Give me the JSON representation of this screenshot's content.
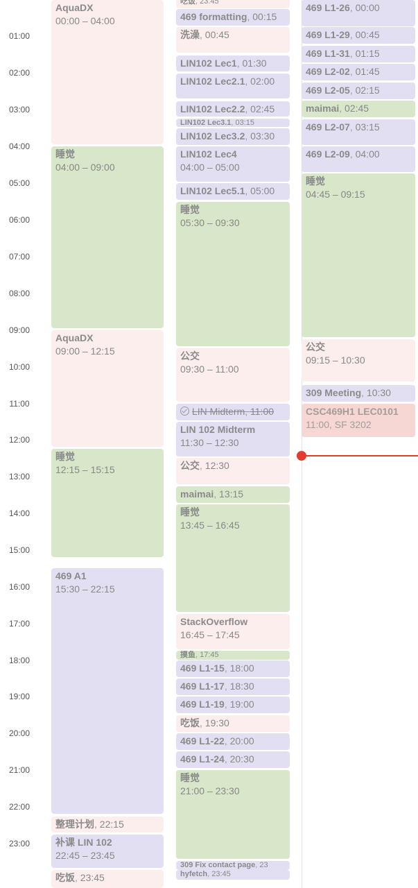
{
  "timeline": {
    "hours": [
      "01:00",
      "02:00",
      "03:00",
      "04:00",
      "05:00",
      "06:00",
      "07:00",
      "08:00",
      "09:00",
      "10:00",
      "11:00",
      "12:00",
      "13:00",
      "14:00",
      "15:00",
      "16:00",
      "17:00",
      "18:00",
      "19:00",
      "20:00",
      "21:00",
      "22:00",
      "23:00"
    ]
  },
  "days": [
    {
      "events": [
        {
          "title": "AquaDX",
          "time": "00:00 – 04:00",
          "color": "pink"
        },
        {
          "title": "睡觉",
          "time": "04:00 – 09:00",
          "color": "green"
        },
        {
          "title": "AquaDX",
          "time": "09:00 – 12:15",
          "color": "pink"
        },
        {
          "title": "睡觉",
          "time": "12:15 – 15:15",
          "color": "green"
        },
        {
          "title": "469 A1",
          "time": "15:30 – 22:15",
          "color": "purple"
        },
        {
          "title": "整理计划",
          "time": "22:15",
          "color": "pink"
        },
        {
          "title": "补课 LIN 102",
          "time": "22:45 – 23:45",
          "color": "purple"
        },
        {
          "title": "吃饭",
          "time": "23:45",
          "color": "pink"
        }
      ]
    },
    {
      "events": [
        {
          "title": "吃饭",
          "time": "23:45",
          "color": "pink"
        },
        {
          "title": "469 formatting",
          "time": "00:15",
          "color": "purple"
        },
        {
          "title": "洗澡",
          "time": "00:45",
          "color": "pink"
        },
        {
          "title": "LIN102 Lec1",
          "time": "01:30",
          "color": "purple"
        },
        {
          "title": "LIN102 Lec2.1",
          "time": "02:00",
          "color": "purple"
        },
        {
          "title": "LIN102 Lec2.2",
          "time": "02:45",
          "color": "purple"
        },
        {
          "title": "LIN102 Lec3.1",
          "time": "03:15",
          "color": "purple"
        },
        {
          "title": "LIN102 Lec3.2",
          "time": "03:30",
          "color": "purple"
        },
        {
          "title": "LIN102 Lec4",
          "time": "04:00 – 05:00",
          "color": "purple"
        },
        {
          "title": "LIN102 Lec5.1",
          "time": "05:00",
          "color": "purple"
        },
        {
          "title": "睡觉",
          "time": "05:30 – 09:30",
          "color": "green"
        },
        {
          "title": "公交",
          "time": "09:30 – 11:00",
          "color": "pink"
        },
        {
          "title": "LIN Midterm",
          "time": "11:00",
          "color": "purple"
        },
        {
          "title": "LIN 102 Midterm",
          "time": "11:30 – 12:30",
          "color": "purple"
        },
        {
          "title": "公交",
          "time": "12:30",
          "color": "pink"
        },
        {
          "title": "maimai",
          "time": "13:15",
          "color": "green"
        },
        {
          "title": "睡觉",
          "time": "13:45 – 16:45",
          "color": "green"
        },
        {
          "title": "StackOverflow",
          "time": "16:45 – 17:45",
          "color": "pink"
        },
        {
          "title": "摸鱼",
          "time": "17:45",
          "color": "green"
        },
        {
          "title": "469 L1-15",
          "time": "18:00",
          "color": "purple"
        },
        {
          "title": "469 L1-17",
          "time": "18:30",
          "color": "purple"
        },
        {
          "title": "469 L1-19",
          "time": "19:00",
          "color": "purple"
        },
        {
          "title": "吃饭",
          "time": "19:30",
          "color": "pink"
        },
        {
          "title": "469 L1-22",
          "time": "20:00",
          "color": "purple"
        },
        {
          "title": "469 L1-24",
          "time": "20:30",
          "color": "purple"
        },
        {
          "title": "睡觉",
          "time": "21:00 – 23:30",
          "color": "green"
        },
        {
          "title": "309 Fix contact page",
          "time": "23",
          "color": "purple"
        },
        {
          "title": "hyfetch",
          "time": "23:45",
          "color": "purple"
        }
      ]
    },
    {
      "events": [
        {
          "title": "469 L1-26",
          "time": "00:00",
          "color": "purple"
        },
        {
          "title": "469 L1-29",
          "time": "00:45",
          "color": "purple"
        },
        {
          "title": "469 L1-31",
          "time": "01:15",
          "color": "purple"
        },
        {
          "title": "469 L2-02",
          "time": "01:45",
          "color": "purple"
        },
        {
          "title": "469 L2-05",
          "time": "02:15",
          "color": "purple"
        },
        {
          "title": "maimai",
          "time": "02:45",
          "color": "green"
        },
        {
          "title": "469 L2-07",
          "time": "03:15",
          "color": "purple"
        },
        {
          "title": "469 L2-09",
          "time": "04:00",
          "color": "purple"
        },
        {
          "title": "睡觉",
          "time": "04:45 – 09:15",
          "color": "green"
        },
        {
          "title": "公交",
          "time": "09:15 – 10:30",
          "color": "pink"
        },
        {
          "title": "309 Meeting",
          "time": "10:30",
          "color": "purple"
        },
        {
          "title": "CSC469H1 LEC0101",
          "time": "11:00, SF 3202",
          "color": "red"
        }
      ]
    }
  ],
  "now_time": "12:30"
}
